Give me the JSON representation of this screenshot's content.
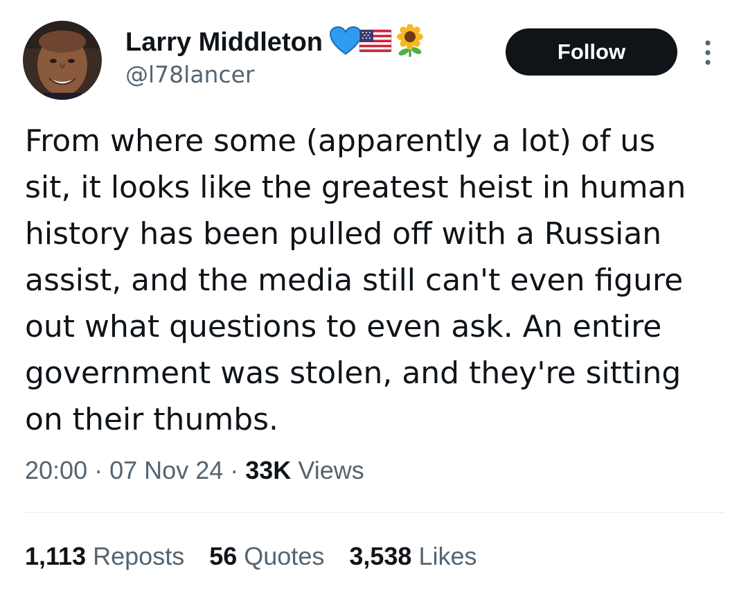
{
  "author": {
    "display_name": "Larry Middleton",
    "handle": "@l78lancer",
    "name_emojis": [
      "blue-heart-icon",
      "us-flag-icon",
      "sunflower-icon"
    ]
  },
  "follow_label": "Follow",
  "tweet": {
    "lines": [
      "From where some (apparently a lot) of us",
      "sit, it looks like the greatest heist in human",
      "history has been pulled off with a Russian",
      "assist, and the media still can't even figure",
      "out what questions to even ask. An entire",
      "government was stolen, and they're sitting",
      "on their thumbs."
    ]
  },
  "meta": {
    "time": "20:00",
    "separator": "·",
    "date": "07 Nov 24",
    "views_count": "33K",
    "views_label": "Views"
  },
  "stats": {
    "reposts_count": "1,113",
    "reposts_label": "Reposts",
    "quotes_count": "56",
    "quotes_label": "Quotes",
    "likes_count": "3,538",
    "likes_label": "Likes"
  },
  "colors": {
    "text_primary": "#0f1419",
    "text_secondary": "#536471",
    "button_bg": "#0f1419",
    "button_text": "#ffffff",
    "divider": "#e6ecf0"
  }
}
